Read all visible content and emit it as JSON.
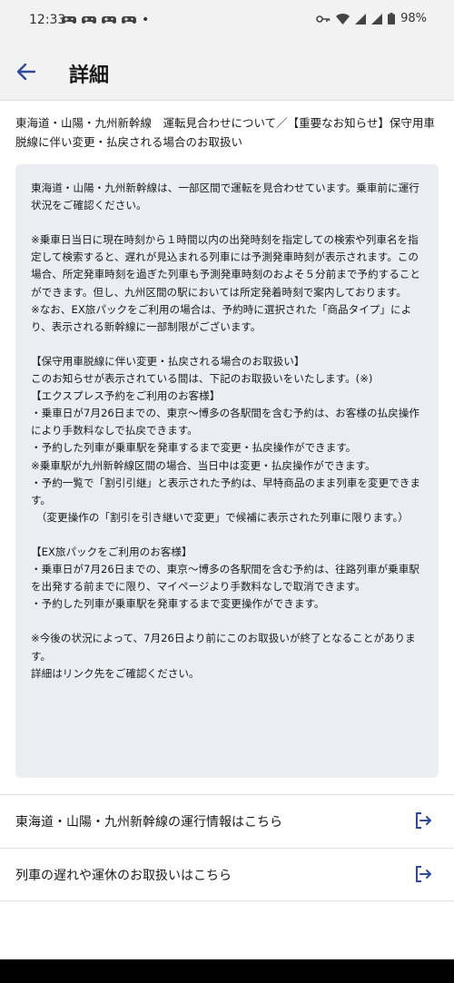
{
  "status_bar": {
    "time": "12:33",
    "dot": "•",
    "battery": "98%"
  },
  "header": {
    "title": "詳細"
  },
  "notice": {
    "title": "東海道・山陽・九州新幹線　運転見合わせについて／【重要なお知らせ】保守用車脱線に伴い変更・払戻される場合のお取扱い",
    "body": "東海道・山陽・九州新幹線は、一部区間で運転を見合わせています。乗車前に運行状況をご確認ください。\n\n※乗車日当日に現在時刻から１時間以内の出発時刻を指定しての検索や列車名を指定して検索すると、遅れが見込まれる列車には予測発車時刻が表示されます。この場合、所定発車時刻を過ぎた列車も予測発車時刻のおよそ５分前まで予約することができます。但し、九州区間の駅においては所定発着時刻で案内しております。\n※なお、EX旅パックをご利用の場合は、予約時に選択された「商品タイプ」により、表示される新幹線に一部制限がございます。\n\n【保守用車脱線に伴い変更・払戻される場合のお取扱い】\nこのお知らせが表示されている間は、下記のお取扱いをいたします。(※)\n【エクスプレス予約をご利用のお客様】\n・乗車日が7月26日までの、東京〜博多の各駅間を含む予約は、お客様の払戻操作により手数料なしで払戻できます。\n・予約した列車が乗車駅を発車するまで変更・払戻操作ができます。\n※乗車駅が九州新幹線区間の場合、当日中は変更・払戻操作ができます。\n・予約一覧で「割引引継」と表示された予約は、早特商品のまま列車を変更できます。\n　（変更操作の「割引を引き継いで変更」で候補に表示された列車に限ります。）\n\n【EX旅パックをご利用のお客様】\n・乗車日が7月26日までの、東京〜博多の各駅間を含む予約は、往路列車が乗車駅を出発する前までに限り、マイページより手数料なしで取消できます。\n・予約した列車が乗車駅を発車するまで変更操作ができます。\n\n※今後の状況によって、7月26日より前にこのお取扱いが終了となることがあります。\n詳細はリンク先をご確認ください。"
  },
  "links": [
    {
      "label": "東海道・山陽・九州新幹線の運行情報はこちら",
      "icon": "external-link-icon"
    },
    {
      "label": "列車の遅れや運休のお取扱いはこちら",
      "icon": "external-link-icon"
    }
  ],
  "colors": {
    "accent": "#2b4aa0",
    "box_background": "#eaeef2",
    "bar_background": "#f2f2f2"
  }
}
